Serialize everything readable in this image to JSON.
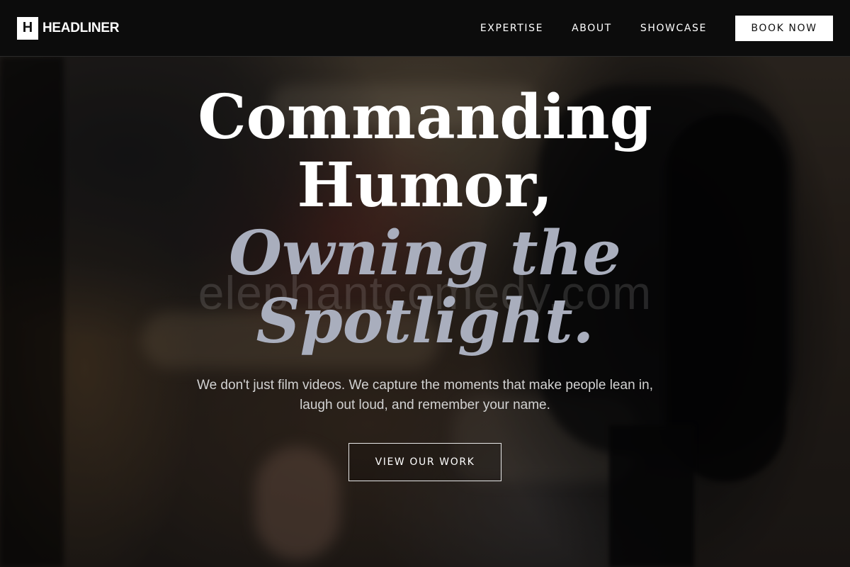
{
  "brand": {
    "mark": "H",
    "name": "HEADLINER"
  },
  "nav": {
    "links": [
      "EXPERTISE",
      "ABOUT",
      "SHOWCASE"
    ],
    "cta": "BOOK NOW"
  },
  "hero": {
    "headline_lines": [
      "Commanding",
      "Humor,"
    ],
    "headline_italic_lines": [
      "Owning the",
      "Spotlight."
    ],
    "watermark": "elephantcomedy.com",
    "subtext": "We don't just film videos. We capture the moments that make people lean in, laugh out loud, and remember your name.",
    "cta": "VIEW OUR WORK"
  },
  "colors": {
    "nav_bg": "#0c0c0c",
    "accent_italic": "#a9aebd",
    "button_bg": "#ffffff"
  }
}
